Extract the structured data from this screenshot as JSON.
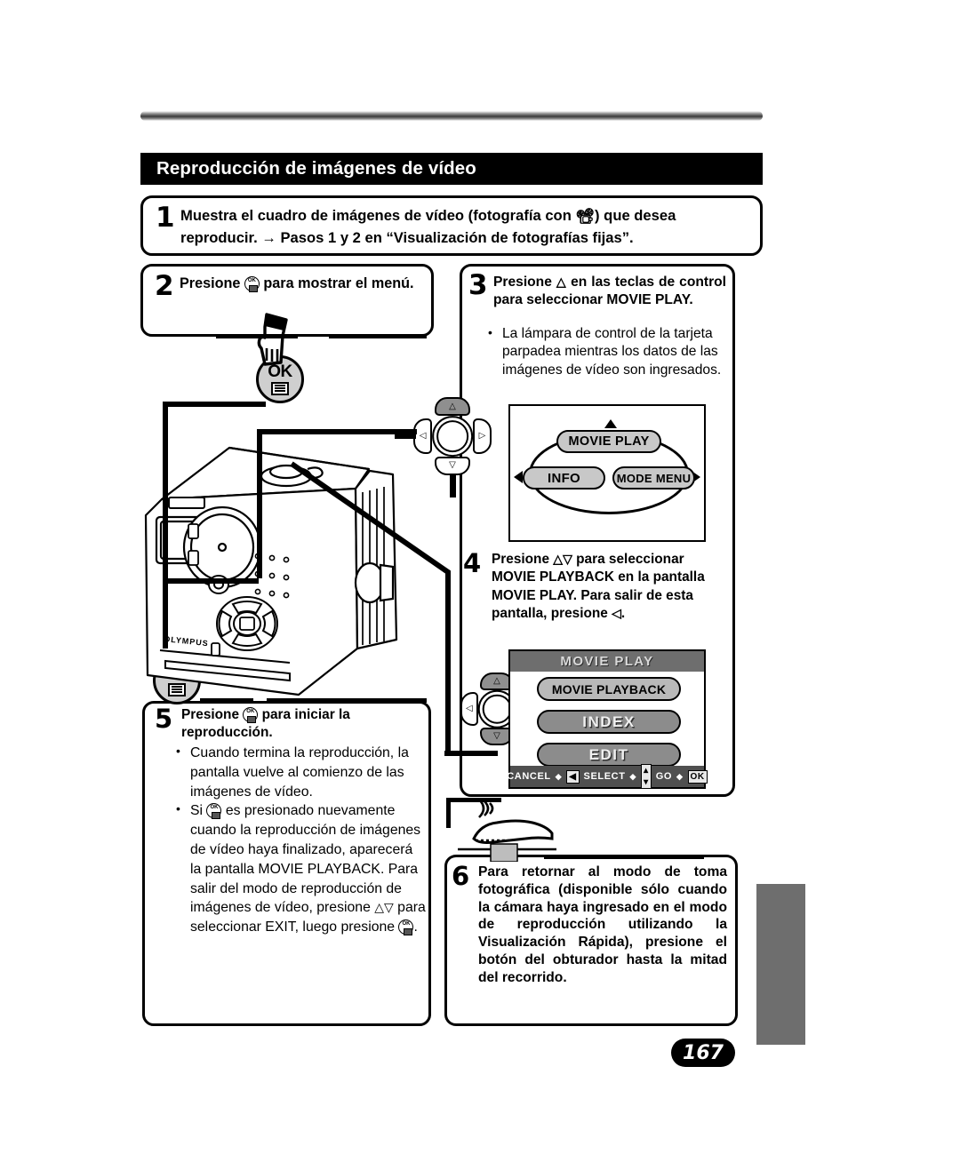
{
  "page": {
    "number": "167",
    "heading": "Reproducción de imágenes de vídeo"
  },
  "steps": [
    {
      "num": "1",
      "text_before_icon": "Muestra el cuadro de imágenes de vídeo (fotografía con ",
      "icon": "movie-camera-icon",
      "text_after_icon": ") que desea reproducir. → Pasos 1 y 2 en “Visualización de fotografías fijas”."
    },
    {
      "num": "2",
      "text_a": "Presione ",
      "icon": "ok-button-icon",
      "text_b": " para mostrar el menú."
    },
    {
      "num": "3",
      "text_a": "Presione ",
      "icon": "triangle-up-icon",
      "text_b": " en las teclas de control para seleccionar MOVIE PLAY.",
      "bullet": "La lámpara de control de la tarjeta parpadea mientras los datos de las imágenes de vídeo son ingresados."
    },
    {
      "num": "4",
      "text_a": "Presione ",
      "icon_up": "triangle-up-icon",
      "icon_down": "triangle-down-icon",
      "text_b": " para seleccionar MOVIE PLAYBACK en la pantalla MOVIE PLAY. Para salir de esta pantalla, presione ",
      "icon_left": "triangle-left-icon",
      "text_c": "."
    },
    {
      "num": "5",
      "text_a": "Presione ",
      "icon": "ok-button-icon",
      "text_b": " para iniciar la reproducción.",
      "bullet_1": "Cuando termina la reproducción, la pantalla vuelve al comienzo de las imágenes de vídeo.",
      "bullet_2_a": "Si ",
      "bullet_2_icon": "ok-button-icon",
      "bullet_2_b": " es presionado nuevamente cuando la reproducción de imágenes de vídeo haya finalizado, aparecerá la pantalla MOVIE PLAYBACK. Para salir del modo de reproducción de imágenes de vídeo, presione ",
      "bullet_2_icons": "△▽",
      "bullet_2_c": " para seleccionar EXIT, luego presione ",
      "bullet_2_icon2": "ok-button-icon",
      "bullet_2_d": "."
    },
    {
      "num": "6",
      "text": "Para retornar al modo de toma fotográfica (disponible sólo cuando la cámara haya ingresado en el modo de reproducción utilizando la Visualización Rápida), presione el botón del obturador hasta la mitad del recorrido."
    }
  ],
  "ok_button": {
    "label": "OK",
    "icon": "menu-list-icon"
  },
  "screen_movie_play": {
    "title_pill": "MOVIE PLAY",
    "left_pill": "INFO",
    "right_pill": "MODE MENU",
    "arrow_up": "triangle-up-icon",
    "arrow_left": "triangle-left-icon",
    "arrow_right": "triangle-right-icon"
  },
  "screen_movie_menu": {
    "title": "MOVIE PLAY",
    "items": [
      {
        "label": "MOVIE PLAYBACK",
        "selected": true
      },
      {
        "label": "INDEX",
        "selected": false
      },
      {
        "label": "EDIT",
        "selected": false
      }
    ],
    "footer": {
      "cancel": "CANCEL",
      "select": "SELECT",
      "go": "GO",
      "ok": "OK"
    }
  },
  "colors": {
    "heading_bg": "#000000",
    "side_tab": "#6e6e6e",
    "pill_gray": "#c8c8c8",
    "menu_gray": "#8c8c8c",
    "screen_title_gray": "#6e6e6e"
  }
}
